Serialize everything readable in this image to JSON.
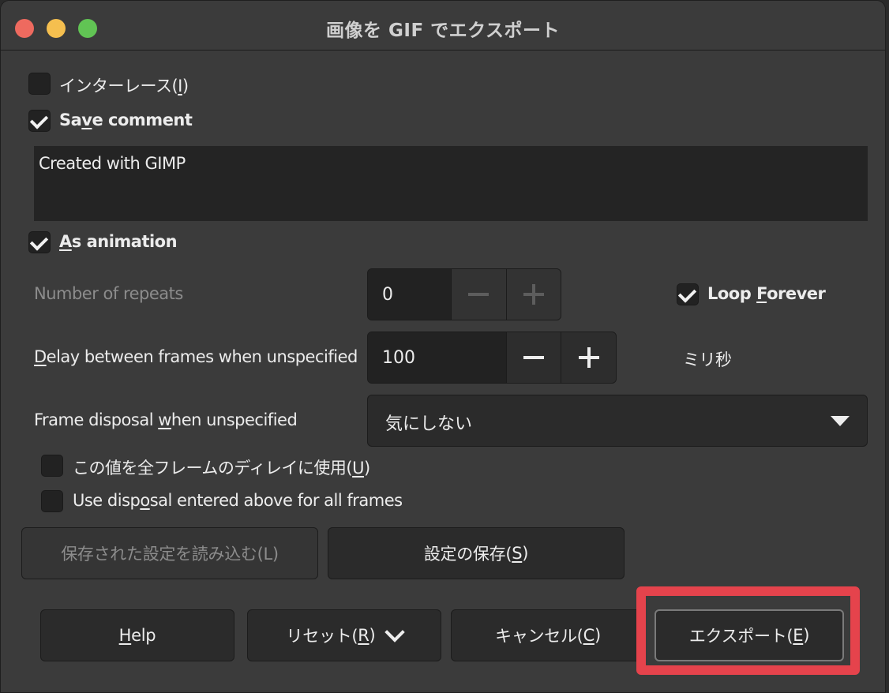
{
  "window": {
    "title": "画像を GIF でエクスポート"
  },
  "options": {
    "interlace": {
      "label_pre": "インターレース(",
      "mnemonic": "I",
      "label_post": ")",
      "checked": false
    },
    "save_comment": {
      "label_pre": "Sa",
      "mnemonic": "v",
      "label_post": "e comment",
      "checked": true
    },
    "comment_text": "Created with GIMP",
    "as_animation": {
      "mnemonic": "A",
      "label_post": "s animation",
      "checked": true
    }
  },
  "animation": {
    "repeats": {
      "label": "Number of repeats",
      "value": "0"
    },
    "loop_forever": {
      "label_pre": "Loop ",
      "mnemonic": "F",
      "label_post": "orever",
      "checked": true
    },
    "delay": {
      "mnemonic": "D",
      "label_post": "elay between frames when unspecified",
      "value": "100",
      "unit": "ミリ秒"
    },
    "disposal": {
      "label_pre": "Frame disposal ",
      "mnemonic": "w",
      "label_post": "hen unspecified",
      "selected": "気にしない"
    },
    "use_delay_all": {
      "label_pre": "この値を全フレームのディレイに使用(",
      "mnemonic": "U",
      "label_post": ")",
      "checked": false
    },
    "use_disposal_all": {
      "label_pre": "Use disp",
      "mnemonic": "o",
      "label_post": "sal entered above for all frames",
      "checked": false
    }
  },
  "settings_buttons": {
    "load": "保存された設定を読み込む(L)",
    "save_pre": "設定の保存(",
    "save_mnemonic": "S",
    "save_post": ")"
  },
  "footer": {
    "help_mnemonic": "H",
    "help_post": "elp",
    "reset_pre": "リセット(",
    "reset_mnemonic": "R",
    "reset_post": ")",
    "cancel_pre": "キャンセル(",
    "cancel_mnemonic": "C",
    "cancel_post": ")",
    "export_pre": "エクスポート(",
    "export_mnemonic": "E",
    "export_post": ")"
  },
  "colors": {
    "highlight": "#e5434c",
    "background": "#3b3b3b"
  }
}
